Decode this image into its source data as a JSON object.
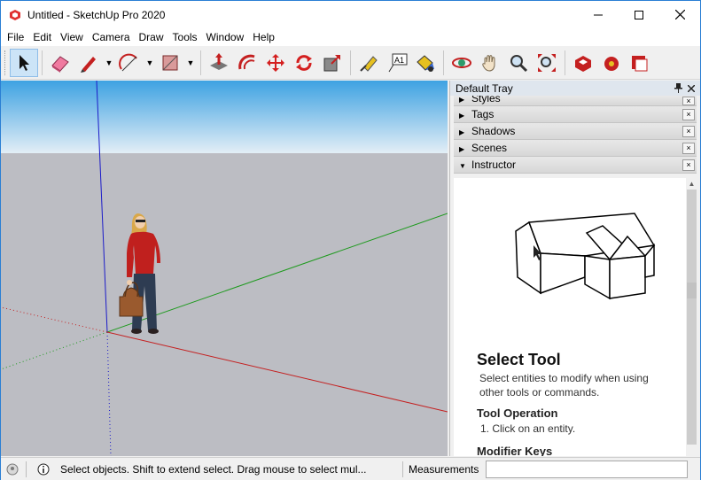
{
  "window": {
    "title": "Untitled - SketchUp Pro 2020"
  },
  "menu": [
    "File",
    "Edit",
    "View",
    "Camera",
    "Draw",
    "Tools",
    "Window",
    "Help"
  ],
  "toolbar": {
    "tools": [
      "select-tool",
      "eraser-tool",
      "pencil-tool",
      "arc-tool",
      "rectangle-tool",
      "push-pull-tool",
      "offset-tool",
      "move-tool",
      "rotate-tool",
      "scale-tool",
      "tape-measure-tool",
      "text-tool",
      "paint-bucket-tool",
      "orbit-tool",
      "pan-tool",
      "zoom-tool",
      "zoom-extents-tool",
      "warehouse-tool",
      "extension-warehouse-tool",
      "layout-tool"
    ],
    "text_tool_label": "A1"
  },
  "tray": {
    "title": "Default Tray",
    "panels": [
      {
        "label": "Styles"
      },
      {
        "label": "Tags"
      },
      {
        "label": "Shadows"
      },
      {
        "label": "Scenes"
      },
      {
        "label": "Instructor"
      }
    ],
    "close_glyph": "×",
    "instructor": {
      "title": "Select Tool",
      "description": "Select entities to modify when using other tools or commands.",
      "operation_heading": "Tool Operation",
      "operation_step": "1. Click on an entity.",
      "modifier_heading": "Modifier Keys"
    }
  },
  "status": {
    "message": "Select objects. Shift to extend select. Drag mouse to select mul...",
    "measurements_label": "Measurements",
    "measurements_value": ""
  },
  "colors": {
    "sky_top": "#3ea2e2",
    "sky_bottom": "#e3eef6",
    "ground": "#bcbdc3",
    "axis_red": "#c42020",
    "axis_green": "#1e9a1e",
    "axis_blue": "#1b1bc8"
  }
}
